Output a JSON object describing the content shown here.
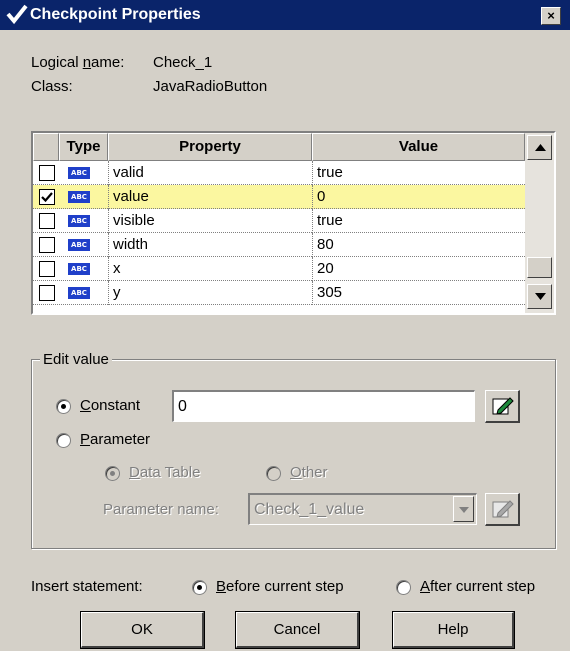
{
  "window": {
    "title": "Checkpoint Properties",
    "close_glyph": "×"
  },
  "info": {
    "logical_name_label": "Logical name:",
    "logical_name_value": "Check_1",
    "class_label": "Class:",
    "class_value": "JavaRadioButton"
  },
  "grid": {
    "headers": [
      "",
      "Type",
      "Property",
      "Value"
    ],
    "type_badge": "ABC",
    "rows": [
      {
        "checked": false,
        "property": "valid",
        "value": "true",
        "selected": false
      },
      {
        "checked": true,
        "property": "value",
        "value": "0",
        "selected": true
      },
      {
        "checked": false,
        "property": "visible",
        "value": "true",
        "selected": false
      },
      {
        "checked": false,
        "property": "width",
        "value": "80",
        "selected": false
      },
      {
        "checked": false,
        "property": "x",
        "value": "20",
        "selected": false
      },
      {
        "checked": false,
        "property": "y",
        "value": "305",
        "selected": false
      }
    ]
  },
  "edit_value": {
    "group_label": "Edit value",
    "constant_label": "Constant",
    "constant_value": "0",
    "parameter_label": "Parameter",
    "data_table_label": "Data Table",
    "other_label": "Other",
    "parameter_name_label": "Parameter name:",
    "parameter_name_value": "Check_1_value",
    "selected_mode": "Constant"
  },
  "insert": {
    "label": "Insert statement:",
    "before_label": "Before current step",
    "after_label": "After current step",
    "selected": "before"
  },
  "buttons": {
    "ok": "OK",
    "cancel": "Cancel",
    "help": "Help"
  }
}
